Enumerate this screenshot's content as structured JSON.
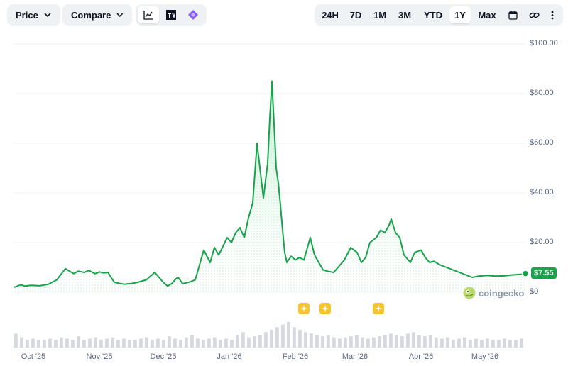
{
  "toolbar": {
    "price_label": "Price",
    "compare_label": "Compare",
    "chart_types": [
      "line-chart-icon",
      "tradingview-icon",
      "ai-diamond-icon"
    ],
    "ranges": [
      "24H",
      "7D",
      "1M",
      "3M",
      "YTD",
      "1Y",
      "Max"
    ],
    "active_range": "1Y",
    "extra_icons": [
      "calendar-icon",
      "link-icon",
      "more-options-icon"
    ]
  },
  "price_badge": "$7.55",
  "watermark": "coingecko",
  "colors": {
    "line": "#16a34a",
    "area_top": "#d1f2dc",
    "badge": "#1aa34a",
    "event": "#f6c42f"
  },
  "chart_data": {
    "type": "area",
    "title": "",
    "xlabel": "",
    "ylabel": "",
    "y_tick_labels": [
      "$100.00",
      "$80.00",
      "$60.00",
      "$40.00",
      "$20.00",
      "$0"
    ],
    "y_ticks": [
      100,
      80,
      60,
      40,
      20,
      0
    ],
    "ylim": [
      -2,
      101
    ],
    "x_tick_labels": [
      "Oct '25",
      "Nov '25",
      "Dec '25",
      "Jan '26",
      "Feb '26",
      "Mar '26",
      "Apr '26",
      "May '26"
    ],
    "x_tick_days": [
      9,
      40,
      70,
      101,
      132,
      160,
      191,
      221
    ],
    "grid": true,
    "legend": "none",
    "series": [
      {
        "x_days": [
          0,
          3,
          5,
          8,
          12,
          16,
          20,
          24,
          28,
          30,
          33,
          35,
          38,
          40,
          42,
          44,
          47,
          50,
          52,
          53,
          55,
          58,
          62,
          66,
          70,
          72,
          74,
          76,
          77,
          79,
          82,
          85,
          89,
          92,
          94,
          96,
          100,
          102,
          104,
          106,
          108,
          110,
          112,
          114,
          117,
          119,
          120,
          121,
          122,
          123,
          124,
          125,
          126,
          127,
          128,
          130,
          132,
          134,
          136,
          137,
          139,
          141,
          143,
          145,
          147,
          150,
          152,
          155,
          158,
          161,
          163,
          165,
          167,
          170,
          172,
          174,
          176,
          177,
          179,
          181,
          183,
          186,
          188,
          191,
          193,
          195,
          197,
          200,
          203,
          206,
          209,
          212,
          215,
          218,
          222,
          226,
          230,
          234,
          238,
          240
        ],
        "values": [
          2.0,
          3.0,
          2.5,
          2.8,
          2.6,
          3.2,
          5.0,
          9.5,
          7.5,
          8.5,
          8.0,
          8.8,
          7.5,
          8.2,
          7.8,
          8.0,
          4.0,
          3.5,
          3.2,
          3.4,
          3.5,
          4.0,
          5.0,
          8.0,
          4.0,
          2.5,
          3.5,
          5.5,
          6.0,
          3.5,
          4.0,
          5.0,
          17.0,
          12.0,
          18.0,
          15.0,
          22.0,
          20.0,
          24.0,
          26.0,
          22.0,
          30.0,
          36.0,
          60.0,
          38.0,
          52.0,
          70.0,
          85.0,
          68.0,
          50.0,
          44.0,
          35.0,
          25.0,
          16.0,
          12.0,
          14.5,
          13.0,
          14.0,
          13.0,
          16.0,
          22.0,
          15.0,
          12.0,
          9.0,
          8.5,
          8.0,
          10.0,
          13.0,
          18.0,
          16.0,
          12.0,
          14.0,
          20.0,
          22.0,
          25.0,
          24.0,
          27.0,
          29.5,
          24.0,
          22.0,
          15.0,
          12.0,
          16.0,
          17.0,
          14.0,
          12.0,
          12.5,
          11.0,
          10.0,
          9.0,
          8.0,
          7.0,
          6.0,
          6.5,
          6.8,
          6.5,
          6.6,
          7.0,
          7.2,
          7.55
        ]
      }
    ],
    "volume_relative": [
      0.55,
      0.4,
      0.3,
      0.35,
      0.3,
      0.3,
      0.35,
      0.3,
      0.4,
      0.35,
      0.3,
      0.45,
      0.3,
      0.35,
      0.4,
      0.3,
      0.35,
      0.4,
      0.3,
      0.35,
      0.3,
      0.3,
      0.35,
      0.4,
      0.3,
      0.35,
      0.3,
      0.45,
      0.35,
      0.3,
      0.4,
      0.5,
      0.35,
      0.3,
      0.35,
      0.4,
      0.3,
      0.35,
      0.3,
      0.5,
      0.6,
      0.4,
      0.45,
      0.5,
      0.6,
      0.7,
      0.8,
      0.9,
      1.0,
      0.8,
      0.7,
      0.6,
      0.55,
      0.5,
      0.45,
      0.5,
      0.4,
      0.35,
      0.4,
      0.45,
      0.5,
      0.4,
      0.35,
      0.4,
      0.45,
      0.5,
      0.55,
      0.5,
      0.45,
      0.55,
      0.6,
      0.5,
      0.45,
      0.5,
      0.4,
      0.35,
      0.4,
      0.3,
      0.35,
      0.4,
      0.3,
      0.35,
      0.3,
      0.35,
      0.3,
      0.3,
      0.35,
      0.3,
      0.3,
      0.35
    ],
    "event_marker_days": [
      136,
      146,
      171
    ]
  }
}
